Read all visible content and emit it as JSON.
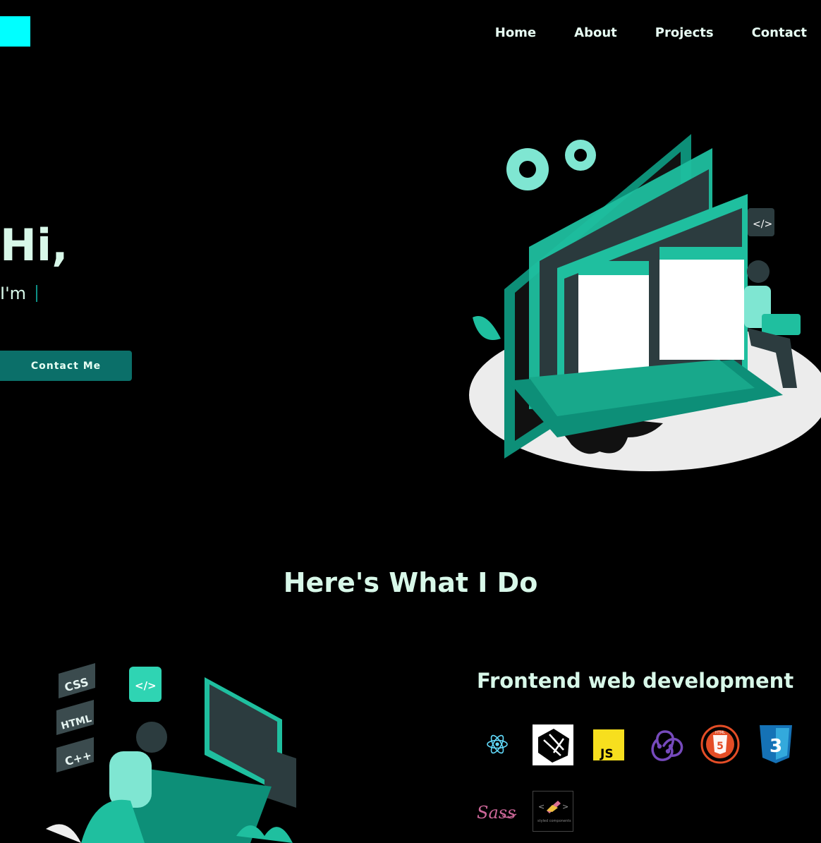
{
  "nav": {
    "items": [
      "Home",
      "About",
      "Projects",
      "Contact"
    ]
  },
  "hero": {
    "greeting": "Hi,",
    "intro": "I'm",
    "cta_label": "Contact Me"
  },
  "section": {
    "title": "Here's What I Do"
  },
  "skill": {
    "title": "Frontend web development",
    "tech_icons": [
      "react-icon",
      "nextjs-icon",
      "javascript-icon",
      "redux-icon",
      "html5-icon",
      "css3-icon",
      "sass-icon",
      "styled-components-icon"
    ],
    "js_badge": "JS",
    "html_badge": "HTML",
    "sass_word": "Sass",
    "styled_caption": "styled components"
  },
  "art_labels": {
    "css": "CSS",
    "html": "HTML",
    "cpp": "C++",
    "code": "</>"
  },
  "colors": {
    "accent": "#00ffff",
    "button": "#0b6f69",
    "teal": "#1fbf9f",
    "text": "#d8f8e9"
  }
}
